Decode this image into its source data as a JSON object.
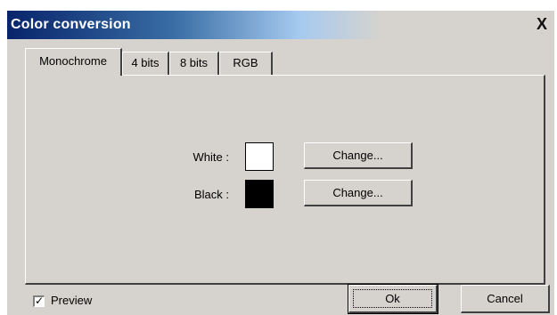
{
  "window": {
    "title": "Color conversion",
    "close_glyph": "X"
  },
  "tabs": [
    {
      "label": "Monochrome",
      "active": true
    },
    {
      "label": "4 bits",
      "active": false
    },
    {
      "label": "8 bits",
      "active": false
    },
    {
      "label": "RGB",
      "active": false
    }
  ],
  "colors": {
    "white": {
      "label": "White :",
      "swatch": "#ffffff",
      "button": "Change..."
    },
    "black": {
      "label": "Black :",
      "swatch": "#000000",
      "button": "Change..."
    }
  },
  "footer": {
    "preview_label": "Preview",
    "preview_checked": true,
    "check_glyph": "✓",
    "ok_label": "Ok",
    "cancel_label": "Cancel"
  }
}
